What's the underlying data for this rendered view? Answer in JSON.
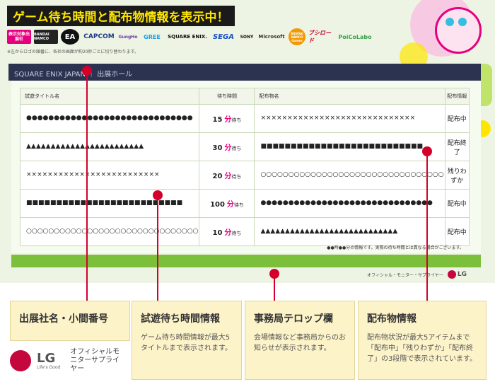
{
  "banner": {
    "title": "ゲーム待ち時間と配布物情報を表示中！",
    "logos": [
      {
        "label": "表示対象出展社",
        "bg": "#e5007f",
        "fg": "#ffffff"
      },
      {
        "label": "BANDAI NAMCO",
        "bg": "#222222",
        "fg": "#ffffff"
      },
      {
        "label": "EA",
        "bg": "#111111",
        "fg": "#ffffff"
      },
      {
        "label": "CAPCOM",
        "bg": "#ffffff",
        "fg": "#1e3a8a"
      },
      {
        "label": "GungHo",
        "bg": "#ffffff",
        "fg": "#6b3aa0"
      },
      {
        "label": "GREE",
        "bg": "#ffffff",
        "fg": "#1aa0e0"
      },
      {
        "label": "SQUARE ENIX.",
        "bg": "#ffffff",
        "fg": "#111111"
      },
      {
        "label": "SEGA",
        "bg": "#ffffff",
        "fg": "#1a4fc0"
      },
      {
        "label": "SONY",
        "bg": "#ffffff",
        "fg": "#111111"
      },
      {
        "label": "Microsoft",
        "bg": "#ffffff",
        "fg": "#333333"
      },
      {
        "label": "BANDAI NAMCO Games",
        "bg": "#f39800",
        "fg": "#ffffff"
      },
      {
        "label": "ブシロード",
        "bg": "#ffffff",
        "fg": "#c4002b"
      },
      {
        "label": "PoiCoLabo",
        "bg": "#ffffff",
        "fg": "#3aa14a"
      }
    ],
    "note": "※左からロゴの順番に、各社の画面が約20秒ごとに切り替わります。"
  },
  "exhibitor_header": {
    "text": "SQUARE ENIX JAPAN ｜ 出展ホール"
  },
  "table": {
    "headers": {
      "title": "試遊タイトル名",
      "wait": "待ち時間",
      "item": "配布物名",
      "status": "配布情報"
    },
    "wait_unit": "分",
    "wait_suffix": "待ち",
    "rows": [
      {
        "game": "●●●●●●●●●●●●●●●●●●●●●●●●●●●●●●",
        "wait": "15",
        "item": "×××××××××××××××××××××××××××××",
        "status": "配布中"
      },
      {
        "game": "▲▲▲▲▲▲▲▲▲▲▲▲▲▲▲▲▲▲▲▲▲▲▲▲",
        "wait": "30",
        "item": "■■■■■■■■■■■■■■■■■■■■■■■■■■■",
        "status": "配布終了"
      },
      {
        "game": "×××××××××××××××××××××××××",
        "wait": "20",
        "item": "○○○○○○○○○○○○○○○○○○○○○○○○○○○○○○○○○",
        "status": "残りわずか"
      },
      {
        "game": "■■■■■■■■■■■■■■■■■■■■■■■■■■",
        "wait": "100",
        "item": "●●●●●●●●●●●●●●●●●●●●●●●●●●●●●●●",
        "status": "配布中"
      },
      {
        "game": "○○○○○○○○○○○○○○○○○○○○○○○○○○○○○○○",
        "wait": "10",
        "item": "▲▲▲▲▲▲▲▲▲▲▲▲▲▲▲▲▲▲▲▲▲▲▲▲▲▲▲▲",
        "status": "配布中"
      }
    ],
    "footnote": "●●時●●分の情報です。実際の待ち時間とは異なる場合がございます。"
  },
  "sponsor": {
    "caption": "オフィシャル・モニター・サプライヤー",
    "logo": "LG",
    "tagline": "Life's Good"
  },
  "callouts": [
    {
      "head": "出展社名・小間番号",
      "desc": ""
    },
    {
      "head": "試遊待ち時間情報",
      "desc": "ゲーム待ち時間情報が最大5タイトルまで表示されます。"
    },
    {
      "head": "事務局テロップ欄",
      "desc": "会場情報など事務局からのお知らせが表示されます。"
    },
    {
      "head": "配布物情報",
      "desc": "配布物状況が最大5アイテムまで「配布中」「残りわずか」「配布終了」の3段階で表示されています。"
    }
  ],
  "footer_logo": {
    "logo": "LG",
    "word": "LG",
    "tagline": "Life's Good",
    "caption": "オフィシャルモニターサプライヤー"
  },
  "colors": {
    "accent_pink": "#e5007f",
    "pin_red": "#d4002b",
    "green_bar": "#7bbf3a",
    "header_navy": "#2b3350",
    "callout_bg": "#fdf3c9"
  }
}
